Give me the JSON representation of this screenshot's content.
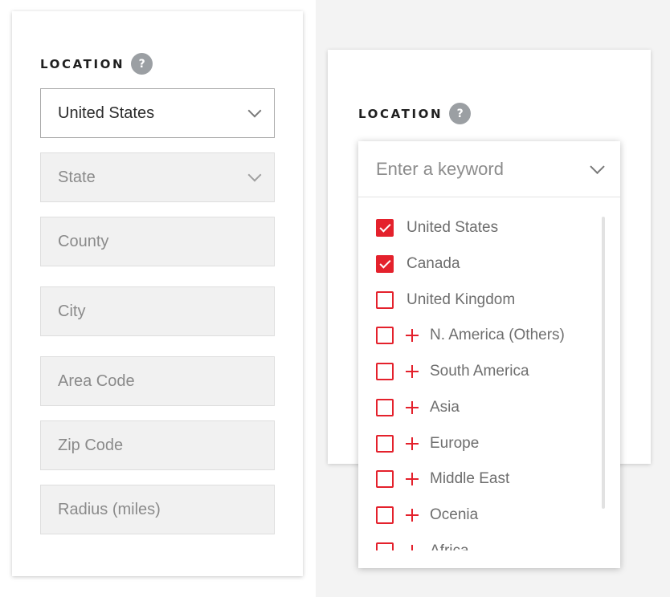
{
  "left_panel": {
    "title": "LOCATION",
    "help": "?",
    "country_select": {
      "value": "United States"
    },
    "state_select": {
      "placeholder": "State"
    },
    "county_input": {
      "placeholder": "County"
    },
    "city_input": {
      "placeholder": "City"
    },
    "area_code_input": {
      "placeholder": "Area Code"
    },
    "zip_code_input": {
      "placeholder": "Zip Code"
    },
    "radius_input": {
      "placeholder": "Radius (miles)"
    }
  },
  "right_panel": {
    "title": "LOCATION",
    "help": "?",
    "keyword_input": {
      "placeholder": "Enter a keyword"
    },
    "options": [
      {
        "label": "United States",
        "checked": true,
        "expandable": false
      },
      {
        "label": "Canada",
        "checked": true,
        "expandable": false
      },
      {
        "label": "United Kingdom",
        "checked": false,
        "expandable": false
      },
      {
        "label": "N. America (Others)",
        "checked": false,
        "expandable": true
      },
      {
        "label": "South America",
        "checked": false,
        "expandable": true
      },
      {
        "label": "Asia",
        "checked": false,
        "expandable": true
      },
      {
        "label": "Europe",
        "checked": false,
        "expandable": true
      },
      {
        "label": "Middle East",
        "checked": false,
        "expandable": true
      },
      {
        "label": "Ocenia",
        "checked": false,
        "expandable": true
      },
      {
        "label": "Africa",
        "checked": false,
        "expandable": true
      }
    ]
  },
  "colors": {
    "accent": "#e4212c",
    "field_bg": "#f1f1f1",
    "help_icon_bg": "#9b9fa3"
  }
}
